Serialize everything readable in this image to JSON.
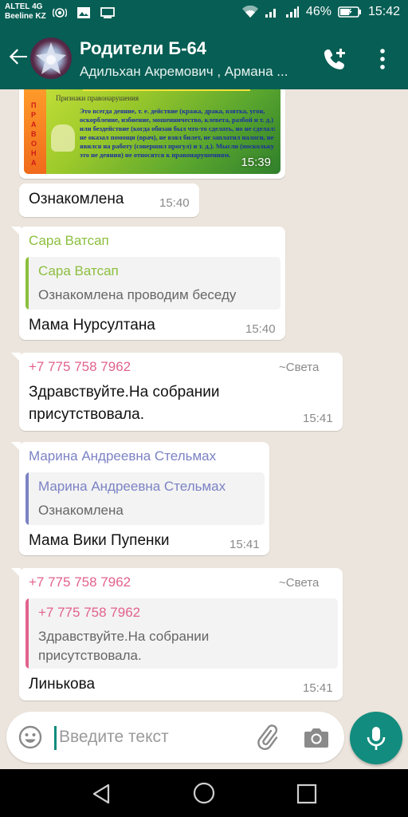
{
  "status_bar": {
    "carrier_1": "ALTEL 4G",
    "carrier_2": "Beeline KZ",
    "battery": "46%",
    "time": "15:42"
  },
  "header": {
    "title": "Родители Б-64",
    "subtitle": "Адильхан Акремович , Армана ..."
  },
  "messages": {
    "image_msg": {
      "time": "15:39",
      "image_heading": "Признаки правонарушения",
      "image_side_text": "ПРАВОНА",
      "image_text": "Это всегда деяние, т. е. действие (кража, драка, взятка, угон, оскорбление, избиение, мошенничество, клевета, разбой и т. д.) или бездействие (когда обязан был что-то сделать, но не сделал: не оказал помощи (врач), не взял билет, не заплатил налоги, не явился на работу (совершил прогул) и т. д.). Мысли (поскольку это не деяния) не относятся к правонарушениям."
    },
    "m1": {
      "text": "Ознакомлена",
      "time": "15:40"
    },
    "m2": {
      "sender": "Сара Ватсап",
      "quote_name": "Сара Ватсап",
      "quote_text": "Ознакомлена проводим беседу",
      "text": "Мама Нурсултана",
      "time": "15:40"
    },
    "m3": {
      "sender": "+7 775 758 7962",
      "pushname": "~Света",
      "text_line1": "Здравствуйте.На собрании",
      "text_line2": "присутствовала.",
      "time": "15:41"
    },
    "m4": {
      "sender": "Марина Андреевна Стельмах",
      "quote_name": "Марина Андреевна Стельмах",
      "quote_text": "Ознакомлена",
      "text": "Мама Вики Пупенки",
      "time": "15:41"
    },
    "m5": {
      "sender": "+7 775 758 7962",
      "pushname": "~Света",
      "quote_name": "+7 775 758 7962",
      "quote_line1": "Здравствуйте.На собрании",
      "quote_line2": "присутствовала.",
      "text": "Линькова",
      "time": "15:41"
    }
  },
  "input": {
    "placeholder": "Введите текст"
  },
  "colors": {
    "header": "#075e54",
    "accent": "#128c7e",
    "sender_green": "#8cbf3f",
    "sender_pink": "#e2628e",
    "sender_purple": "#7c82c4",
    "chat_bg": "#ece5dd"
  },
  "icons": [
    "back-arrow-icon",
    "group-avatar",
    "add-call-icon",
    "more-vert-icon",
    "emoji-icon",
    "attach-icon",
    "camera-icon",
    "mic-icon",
    "nav-back-icon",
    "nav-home-icon",
    "nav-recent-icon"
  ]
}
